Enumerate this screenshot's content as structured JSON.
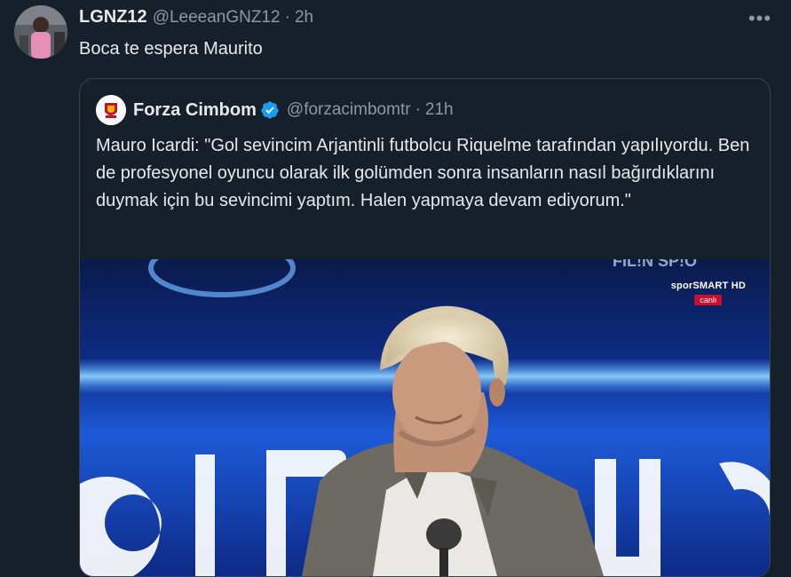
{
  "tweet": {
    "name": "LGNZ12",
    "handle": "@LeeeanGNZ12",
    "separator": "·",
    "time": "2h",
    "text": "Boca te espera Maurito",
    "more_icon": "more-icon",
    "more_label": "•••"
  },
  "quote": {
    "name": "Forza Cimbom",
    "verified_icon": "verified-badge-icon",
    "handle": "@forzacimbomtr",
    "separator": "·",
    "time": "21h",
    "text": "Mauro Icardi: \"Gol sevincim Arjantinli futbolcu Riquelme tarafından yapılıyordu. Ben de profesyonel oyuncu olarak ilk golümden sonra insanların nasıl bağırdıklarını duymak için bu sevincimi yaptım. Halen yapmaya devam ediyorum.\"",
    "media": {
      "broadcast_brand": "sporSMART HD",
      "live_label": "canlı"
    }
  },
  "colors": {
    "background": "#15202b",
    "text": "#e7e9ea",
    "secondary": "#8b98a5",
    "border": "#38444d",
    "verified": "#1d9bf0"
  }
}
